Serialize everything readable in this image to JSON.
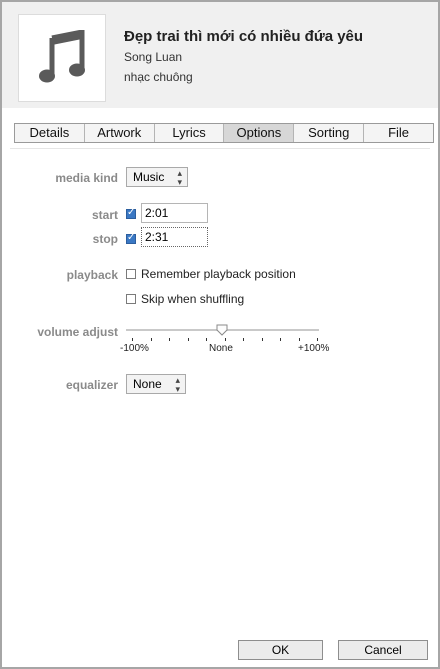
{
  "song": {
    "title": "Đẹp trai thì mới có nhiều đứa yêu",
    "artist": "Song Luan",
    "genre": "nhạc chuông",
    "artwork_icon": "music-note-icon"
  },
  "tabs": [
    {
      "label": "Details",
      "active": false
    },
    {
      "label": "Artwork",
      "active": false
    },
    {
      "label": "Lyrics",
      "active": false
    },
    {
      "label": "Options",
      "active": true
    },
    {
      "label": "Sorting",
      "active": false
    },
    {
      "label": "File",
      "active": false
    }
  ],
  "options": {
    "media_kind_label": "media kind",
    "media_kind_value": "Music",
    "start_label": "start",
    "start_checked": true,
    "start_value": "2:01",
    "stop_label": "stop",
    "stop_checked": true,
    "stop_value": "2:31",
    "playback_label": "playback",
    "remember_label": "Remember playback position",
    "remember_checked": false,
    "skip_label": "Skip when shuffling",
    "skip_checked": false,
    "volume_label": "volume adjust",
    "volume_min": "-100%",
    "volume_mid": "None",
    "volume_max": "+100%",
    "volume_value": 0,
    "equalizer_label": "equalizer",
    "equalizer_value": "None"
  },
  "buttons": {
    "ok": "OK",
    "cancel": "Cancel"
  }
}
